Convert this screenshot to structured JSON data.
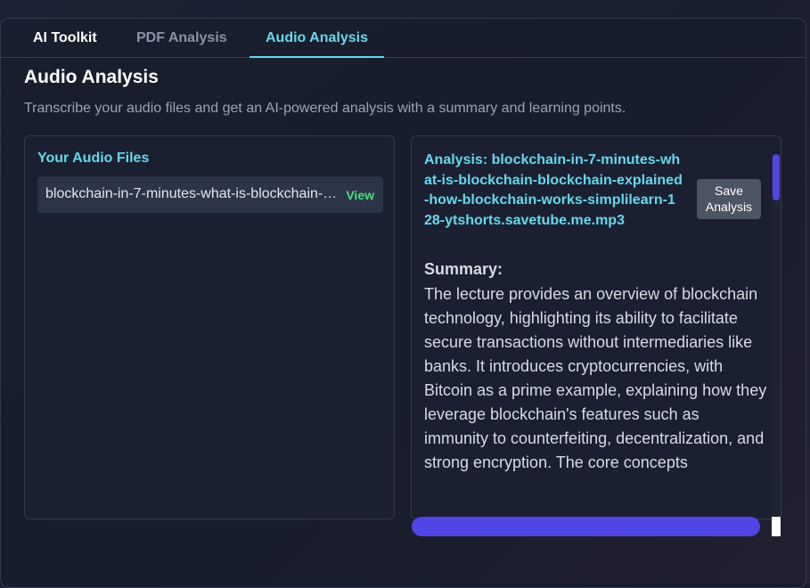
{
  "tabs": [
    {
      "label": "AI Toolkit"
    },
    {
      "label": "PDF Analysis"
    },
    {
      "label": "Audio Analysis"
    }
  ],
  "page": {
    "title": "Audio Analysis",
    "description": "Transcribe your audio files and get an AI-powered analysis with a summary and learning points."
  },
  "files": {
    "title": "Your Audio Files",
    "items": [
      {
        "name": "blockchain-in-7-minutes-what-is-blockchain-blockchain-explained-how-blockchain-works-simplilearn-128-ytshorts.savetube.me.mp3",
        "action": "View"
      }
    ]
  },
  "analysis": {
    "title": "Analysis: blockchain-in-7-minutes-what-is-blockchain-blockchain-explained-how-blockchain-works-simplilearn-128-ytshorts.savetube.me.mp3",
    "save_label": "Save Analysis",
    "summary_heading": "Summary:",
    "summary_text": "The lecture provides an overview of blockchain technology, highlighting its ability to facilitate secure transactions without intermediaries like banks. It introduces cryptocurrencies, with Bitcoin as a prime example, explaining how they leverage blockchain's features such as immunity to counterfeiting, decentralization, and strong encryption. The core concepts"
  },
  "colors": {
    "accent": "#67d7ec",
    "view_link": "#4ade80",
    "scrollbar": "#4f46e5"
  }
}
